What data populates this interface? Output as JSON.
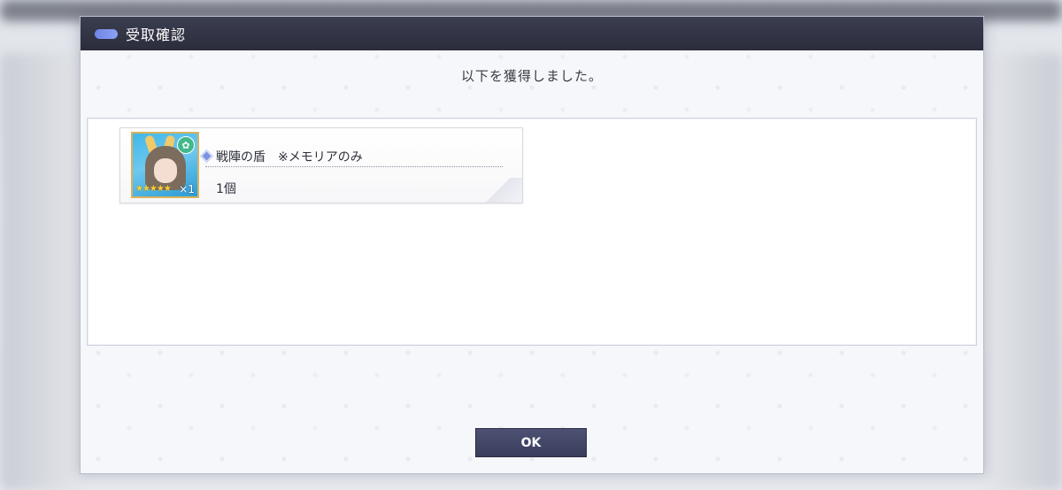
{
  "dialog": {
    "title": "受取確認",
    "message": "以下を獲得しました。",
    "ok_label": "OK"
  },
  "rewards": [
    {
      "name": "戦陣の盾　※メモリアのみ",
      "quantity": "1個",
      "multiplier": "×1",
      "stars": "★★★★★",
      "badge_icon": "character-type-icon"
    }
  ],
  "colors": {
    "titlebar": "#2b2d3c",
    "accent_pill": "#7b90ee",
    "button": "#3f4362",
    "card_border": "#d8b25b"
  }
}
